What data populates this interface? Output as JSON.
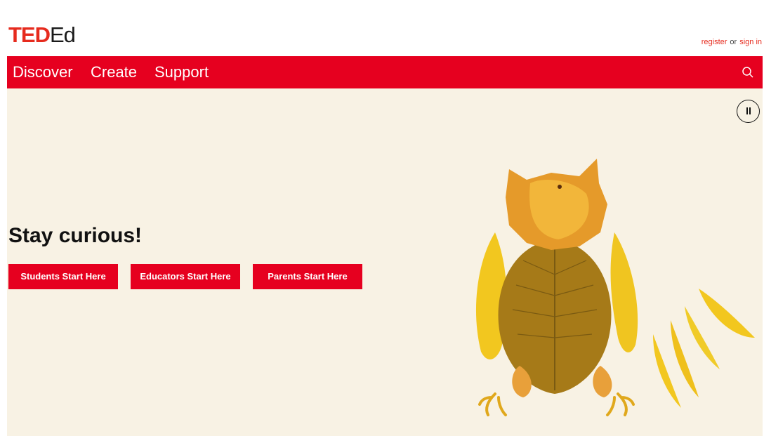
{
  "logo": {
    "ted": "TED",
    "ed": "Ed"
  },
  "auth": {
    "register": "register",
    "separator": "or",
    "sign_in": "sign in"
  },
  "nav": {
    "items": [
      "Discover",
      "Create",
      "Support"
    ]
  },
  "hero": {
    "headline": "Stay curious!",
    "buttons": [
      "Students Start Here",
      "Educators Start Here",
      "Parents Start Here"
    ]
  },
  "icons": {
    "search": "search-icon",
    "pause": "pause-icon",
    "illustration": "leaf-owl-illustration"
  },
  "colors": {
    "brand_red": "#e6001f",
    "logo_red": "#e62b1e",
    "hero_bg": "#f8f2e4"
  }
}
